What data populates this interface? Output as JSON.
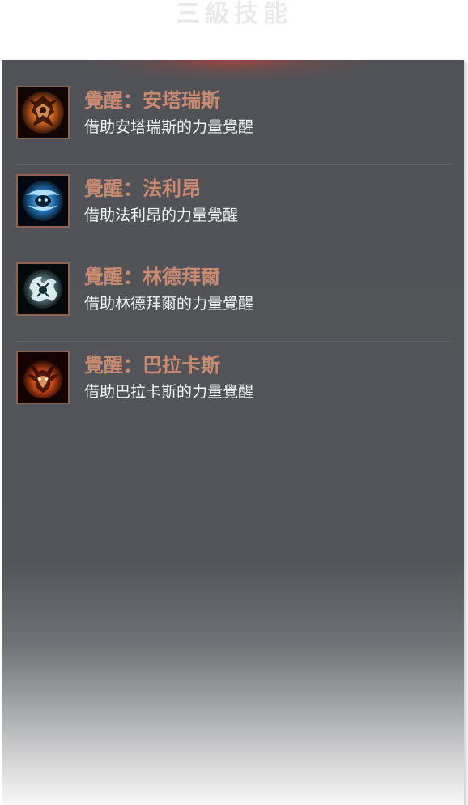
{
  "header": {
    "title": "三級技能"
  },
  "skills": [
    {
      "name": "覺醒：安塔瑞斯",
      "description": "借助安塔瑞斯的力量覺醒",
      "icon": "antaras-awakening-icon",
      "glow_color": "#ff8a3a"
    },
    {
      "name": "覺醒：法利昂",
      "description": "借助法利昂的力量覺醒",
      "icon": "fafurion-awakening-icon",
      "glow_color": "#4ab8ff"
    },
    {
      "name": "覺醒：林德拜爾",
      "description": "借助林德拜爾的力量覺醒",
      "icon": "lindvior-awakening-icon",
      "glow_color": "#bfe6f0"
    },
    {
      "name": "覺醒：巴拉卡斯",
      "description": "借助巴拉卡斯的力量覺醒",
      "icon": "valakas-awakening-icon",
      "glow_color": "#ff6a2a"
    }
  ],
  "colors": {
    "skill_name": "#c98a70",
    "skill_desc": "#f2f2f2",
    "panel": "#505257",
    "icon_border": "#8d6352"
  }
}
